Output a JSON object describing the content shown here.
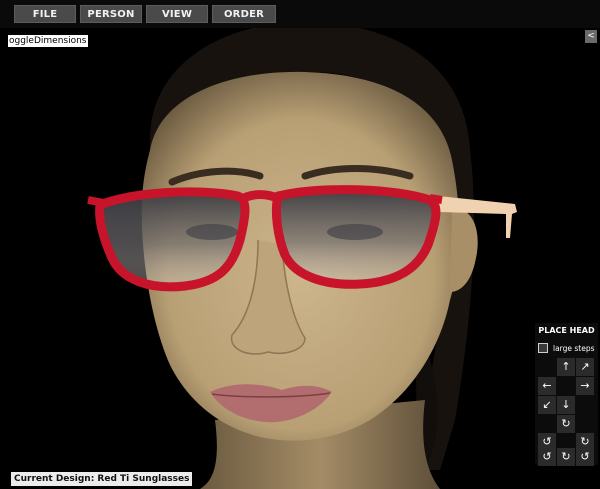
{
  "menu": {
    "items": [
      "FILE",
      "PERSON",
      "VIEW",
      "ORDER"
    ]
  },
  "toggle_label": "oggleDimensions",
  "collapse_glyph": "<",
  "status": {
    "text": "Current Design: Red Ti Sunglasses"
  },
  "place_head": {
    "title": "PLACE HEAD",
    "large_steps_label": "large steps",
    "large_steps_checked": false,
    "buttons": [
      {
        "name": "move-up-button",
        "glyph": "↑",
        "icon": "arrow-up-icon"
      },
      {
        "name": "move-up-right-button",
        "glyph": "↗",
        "icon": "arrow-up-right-icon"
      },
      {
        "name": "move-left-button",
        "glyph": "←",
        "icon": "arrow-left-icon"
      },
      {
        "name": "move-right-button",
        "glyph": "→",
        "icon": "arrow-right-icon"
      },
      {
        "name": "move-down-left-button",
        "glyph": "↙",
        "icon": "arrow-down-left-icon"
      },
      {
        "name": "move-down-button",
        "glyph": "↓",
        "icon": "arrow-down-icon"
      },
      {
        "name": "rotate-button-1",
        "glyph": "↻",
        "icon": "rotate-icon"
      },
      {
        "name": "rotate-button-2",
        "glyph": "↺",
        "icon": "rotate-icon"
      },
      {
        "name": "rotate-button-3",
        "glyph": "↻",
        "icon": "rotate-icon"
      },
      {
        "name": "rotate-button-4",
        "glyph": "↺",
        "icon": "rotate-icon"
      },
      {
        "name": "rotate-button-5",
        "glyph": "↻",
        "icon": "rotate-icon"
      },
      {
        "name": "rotate-button-6",
        "glyph": "↺",
        "icon": "rotate-icon"
      }
    ]
  },
  "colors": {
    "frame_red": "#c8142a",
    "temple_beige": "#f0d2b0",
    "skin": "#c7ad83",
    "hair": "#1a1410",
    "lips": "#b26e6e",
    "lens_top": "#3f3f44",
    "lens_bottom": "#c2bcb6"
  }
}
